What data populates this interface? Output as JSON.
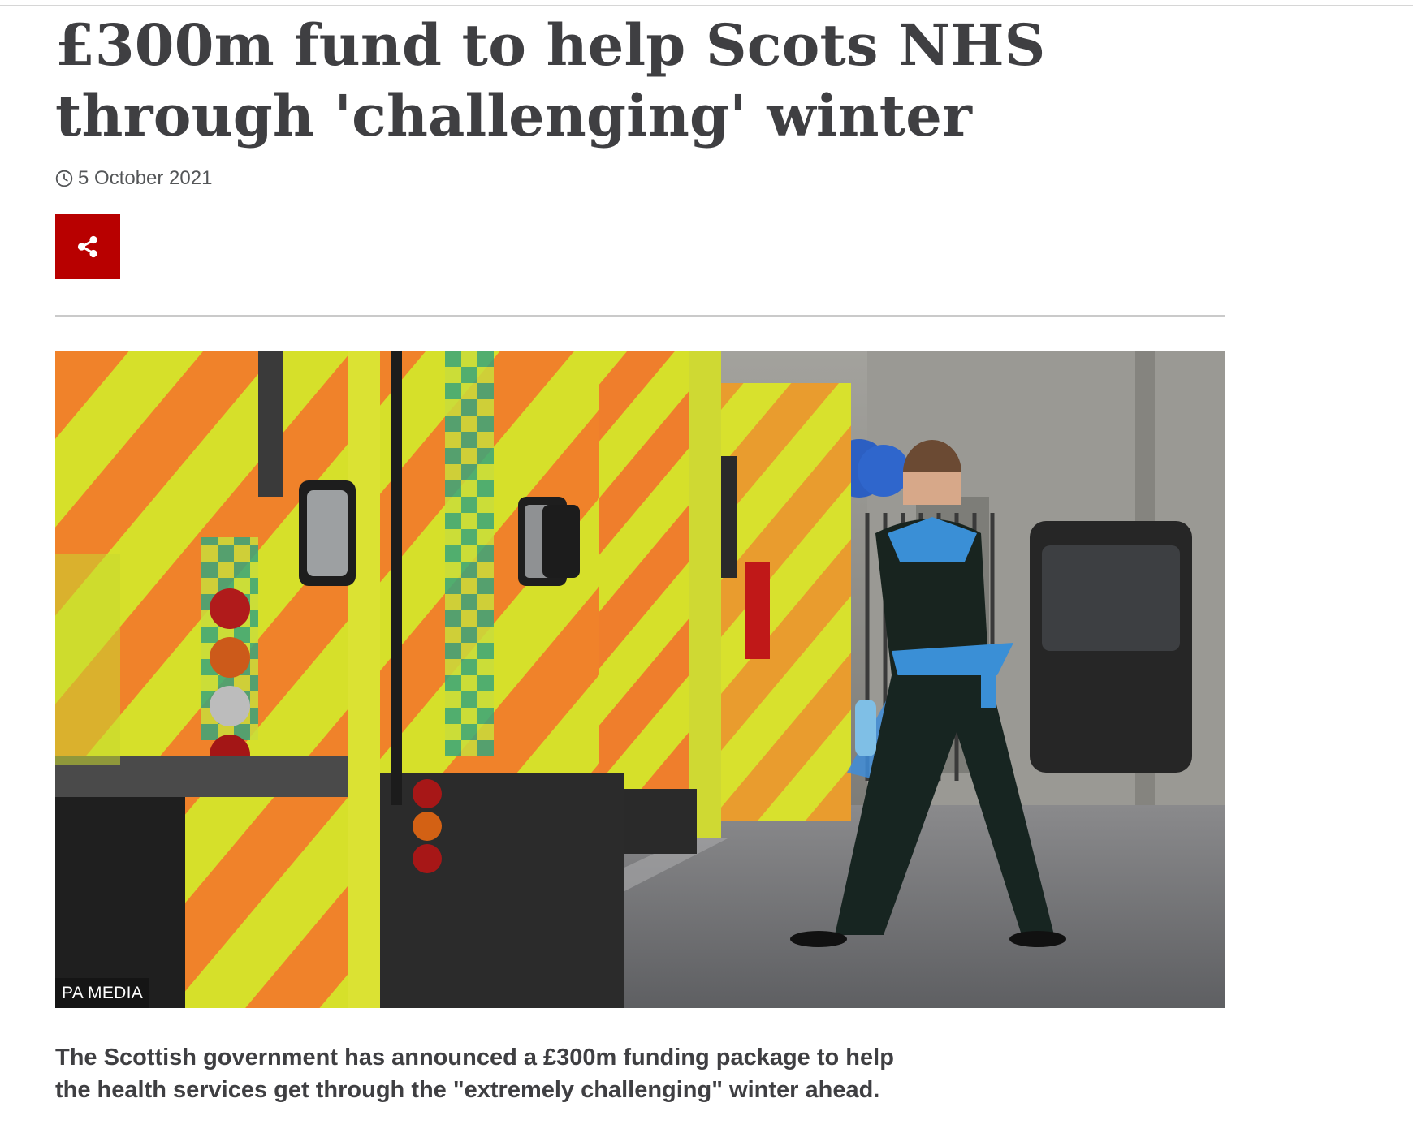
{
  "article": {
    "headline": "£300m fund to help Scots NHS through 'challenging' winter",
    "date": "5 October 2021",
    "image_credit": "PA MEDIA",
    "summary": "The Scottish government has announced a £300m funding package to help the health services get through the \"extremely challenging\" winter ahead."
  },
  "share": {
    "icon": "share-icon",
    "color": "#b80000"
  },
  "icons": {
    "date": "clock-icon"
  },
  "colors": {
    "text": "#3f3f42",
    "meta": "#545658",
    "divider": "#cacaca",
    "accent": "#b80000"
  }
}
